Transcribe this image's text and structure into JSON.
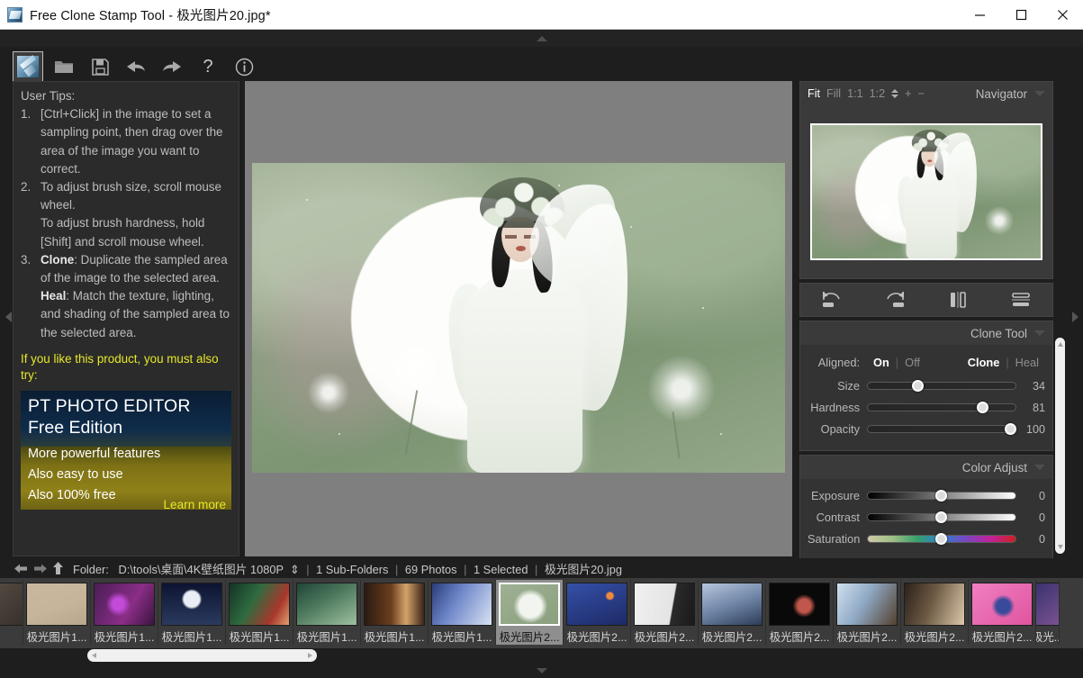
{
  "window": {
    "title": "Free Clone Stamp Tool - 极光图片20.jpg*",
    "app_icon": "clone-stamp-icon",
    "minimize": "—",
    "maximize": "□",
    "close": "✕"
  },
  "toolbar": {
    "items": [
      {
        "name": "clone-stamp-tool",
        "label": "Clone Stamp Tool",
        "selected": true
      },
      {
        "name": "open-icon",
        "label": "Open"
      },
      {
        "name": "save-icon",
        "label": "Save"
      },
      {
        "name": "undo-icon",
        "label": "Undo"
      },
      {
        "name": "redo-icon",
        "label": "Redo"
      },
      {
        "name": "help-icon",
        "label": "?"
      },
      {
        "name": "info-icon",
        "label": "About"
      }
    ],
    "help_glyph": "?"
  },
  "tips": {
    "heading": "User Tips:",
    "items": [
      {
        "num": "1.",
        "text": "[Ctrl+Click] in the image to set a sampling point, then drag over the area of the image you want to correct."
      },
      {
        "num": "2.",
        "text": "To adjust brush size, scroll mouse wheel."
      },
      {
        "num": "",
        "text": "To adjust brush hardness, hold [Shift] and scroll mouse wheel."
      },
      {
        "num": "3.",
        "bold": "Clone",
        "text": ": Duplicate the sampled area of the image to the selected area."
      },
      {
        "num": "",
        "bold": "Heal",
        "text": ": Match the texture, lighting, and shading of the sampled area to the selected area."
      }
    ]
  },
  "promo": {
    "lead": "If you like this product, you must also try:",
    "title_line1": "PT PHOTO EDITOR",
    "title_line2": "Free Edition",
    "bullet1": "More powerful features",
    "bullet2": "Also easy to use",
    "bullet3": "Also 100% free",
    "learn_more": "Learn more"
  },
  "navigator": {
    "panel_title": "Navigator",
    "collapse_icon": "chevron-down-icon",
    "zoom_modes": [
      {
        "label": "Fit",
        "active": true
      },
      {
        "label": "Fill",
        "active": false
      },
      {
        "label": "1:1",
        "active": false
      },
      {
        "label": "1:2",
        "active": false
      }
    ],
    "zoom_in": "+",
    "zoom_out": "−"
  },
  "transform_bar": {
    "buttons": [
      {
        "name": "rotate-left-icon",
        "label": "Rotate Left"
      },
      {
        "name": "rotate-right-icon",
        "label": "Rotate Right"
      },
      {
        "name": "flip-horizontal-icon",
        "label": "Flip Horizontal"
      },
      {
        "name": "flip-vertical-icon",
        "label": "Flip Vertical"
      }
    ]
  },
  "clone_tool": {
    "panel_title": "Clone Tool",
    "collapse_icon": "chevron-down-icon",
    "aligned_label": "Aligned:",
    "aligned_on": "On",
    "aligned_off": "Off",
    "aligned_selected": "On",
    "mode_clone": "Clone",
    "mode_heal": "Heal",
    "mode_selected": "Clone",
    "sliders": [
      {
        "label": "Size",
        "value": "34",
        "percent": 34,
        "track": "plain"
      },
      {
        "label": "Hardness",
        "value": "81",
        "percent": 78,
        "track": "plain"
      },
      {
        "label": "Opacity",
        "value": "100",
        "percent": 98,
        "track": "plain"
      }
    ]
  },
  "color_adjust": {
    "panel_title": "Color Adjust",
    "collapse_icon": "chevron-down-icon",
    "sliders": [
      {
        "label": "Exposure",
        "value": "0",
        "percent": 50,
        "track": "bw"
      },
      {
        "label": "Contrast",
        "value": "0",
        "percent": 50,
        "track": "bw"
      },
      {
        "label": "Saturation",
        "value": "0",
        "percent": 50,
        "track": "sat"
      }
    ]
  },
  "status": {
    "back_icon": "arrow-left-icon",
    "forward_icon": "arrow-right-icon",
    "up_icon": "arrow-up-icon",
    "folder_label": "Folder:",
    "folder_path": "D:\\tools\\桌面\\4K壁纸图片 1080P",
    "subfolders": "1 Sub-Folders",
    "photos": "69 Photos",
    "selected": "1 Selected",
    "filename": "极光图片20.jpg"
  },
  "filmstrip": {
    "thumbs": [
      {
        "caption": "",
        "partial": true,
        "colors": [
          "#5a4f46",
          "#2f2a26"
        ]
      },
      {
        "caption": "极光图片1...",
        "colors": [
          "#c6b49b",
          "#d8c8b2"
        ]
      },
      {
        "caption": "极光图片1...",
        "colors": [
          "#4a1d56",
          "#8a2e86"
        ]
      },
      {
        "caption": "极光图片1...",
        "colors": [
          "#101a33",
          "#2a3a5e"
        ]
      },
      {
        "caption": "极光图片1...",
        "colors": [
          "#123326",
          "#7a2f2a"
        ]
      },
      {
        "caption": "极光图片1...",
        "colors": [
          "#1f4437",
          "#7c9a76"
        ]
      },
      {
        "caption": "极光图片1...",
        "colors": [
          "#2b1a12",
          "#a06a3c"
        ]
      },
      {
        "caption": "极光图片1...",
        "colors": [
          "#2a3c7a",
          "#c9d4ea"
        ]
      },
      {
        "caption": "极光图片2...",
        "selected": true,
        "colors": [
          "#93a98a",
          "#e6eae1"
        ]
      },
      {
        "caption": "极光图片2...",
        "colors": [
          "#1f2f7a",
          "#5f7ad0"
        ]
      },
      {
        "caption": "极光图片2...",
        "colors": [
          "#e8e8e8",
          "#2a2a2a"
        ]
      },
      {
        "caption": "极光图片2...",
        "colors": [
          "#3a4b6e",
          "#9fb0cc"
        ]
      },
      {
        "caption": "极光图片2...",
        "colors": [
          "#0b0b0b",
          "#7a2a2a"
        ]
      },
      {
        "caption": "极光图片2...",
        "colors": [
          "#b9cbe0",
          "#6a4a3a"
        ]
      },
      {
        "caption": "极光图片2...",
        "colors": [
          "#d2c8b4",
          "#3a2a22"
        ]
      },
      {
        "caption": "极光图片2...",
        "colors": [
          "#e86fb0",
          "#3a3a8a"
        ]
      },
      {
        "caption": "极光...",
        "partial": true,
        "colors": [
          "#2a2a66",
          "#8a5a9a"
        ]
      }
    ]
  },
  "edges": {
    "top_collapse": "collapse-top-arrow",
    "bottom_collapse": "collapse-bottom-arrow",
    "left_collapse": "collapse-left-arrow",
    "right_collapse": "collapse-right-arrow"
  }
}
